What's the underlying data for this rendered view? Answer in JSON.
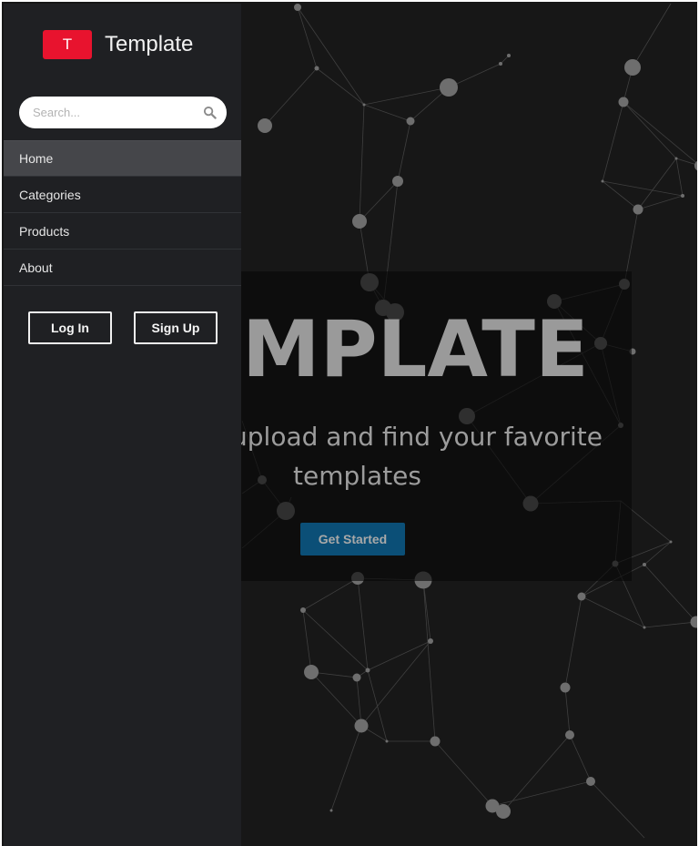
{
  "brand": {
    "badge": "T",
    "name": "Template"
  },
  "search": {
    "placeholder": "Search..."
  },
  "nav": {
    "items": [
      {
        "label": "Home",
        "active": true
      },
      {
        "label": "Categories",
        "active": false
      },
      {
        "label": "Products",
        "active": false
      },
      {
        "label": "About",
        "active": false
      }
    ]
  },
  "auth": {
    "login_label": "Log In",
    "signup_label": "Sign Up"
  },
  "hero": {
    "title": "MPLATE",
    "subtitle_line1": "o upload and find your favorite",
    "subtitle_line2": "templates",
    "cta_label": "Get Started"
  },
  "colors": {
    "accent": "#e8132e",
    "cta": "#0b4f77",
    "sidebar": "#1f2023",
    "background": "#171717"
  }
}
